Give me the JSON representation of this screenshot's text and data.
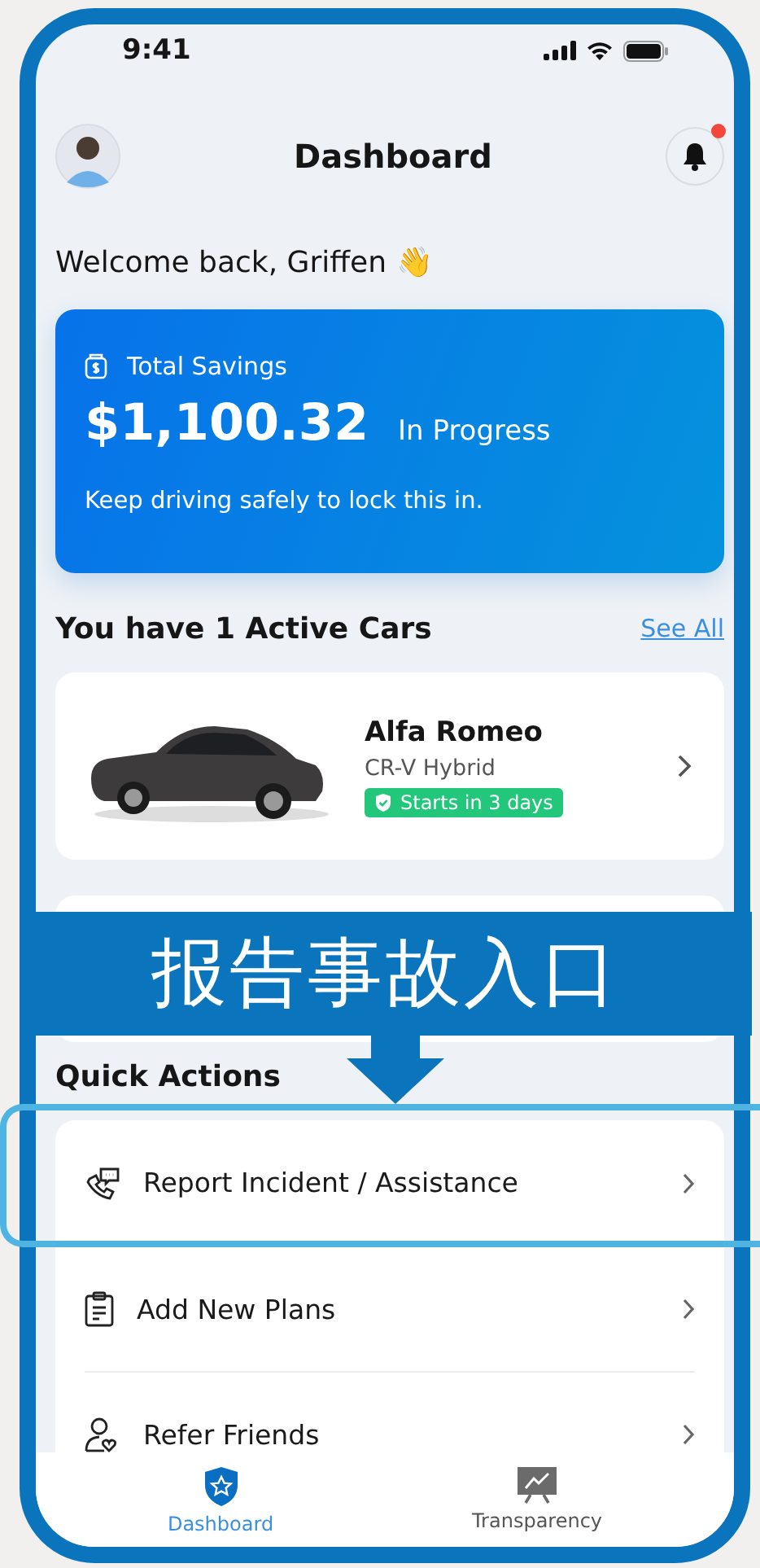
{
  "status_bar": {
    "time": "9:41"
  },
  "header": {
    "title": "Dashboard",
    "notification_badge": true
  },
  "greeting": {
    "text": "Welcome back, Griffen",
    "emoji": "👋"
  },
  "savings_card": {
    "label": "Total Savings",
    "amount": "$1,100.32",
    "status": "In Progress",
    "note": "Keep driving safely to lock this in."
  },
  "active_cars": {
    "title": "You have 1 Active Cars",
    "link": "See All",
    "cars": [
      {
        "name": "Alfa Romeo",
        "model": "CR-V Hybrid",
        "badge": "Starts in 3 days"
      }
    ]
  },
  "annotation": {
    "text": "报告事故入口"
  },
  "quick_actions": {
    "title": "Quick Actions",
    "items": [
      {
        "kind": "incident",
        "label": "Report Incident / Assistance",
        "highlighted": true
      },
      {
        "kind": "plans",
        "label": "Add New Plans",
        "highlighted": false
      },
      {
        "kind": "refer",
        "label": "Refer Friends",
        "highlighted": false
      }
    ]
  },
  "tab_bar": [
    {
      "kind": "shield",
      "label": "Dashboard",
      "selected": true
    },
    {
      "kind": "chart",
      "label": "Transparency",
      "selected": false
    }
  ]
}
